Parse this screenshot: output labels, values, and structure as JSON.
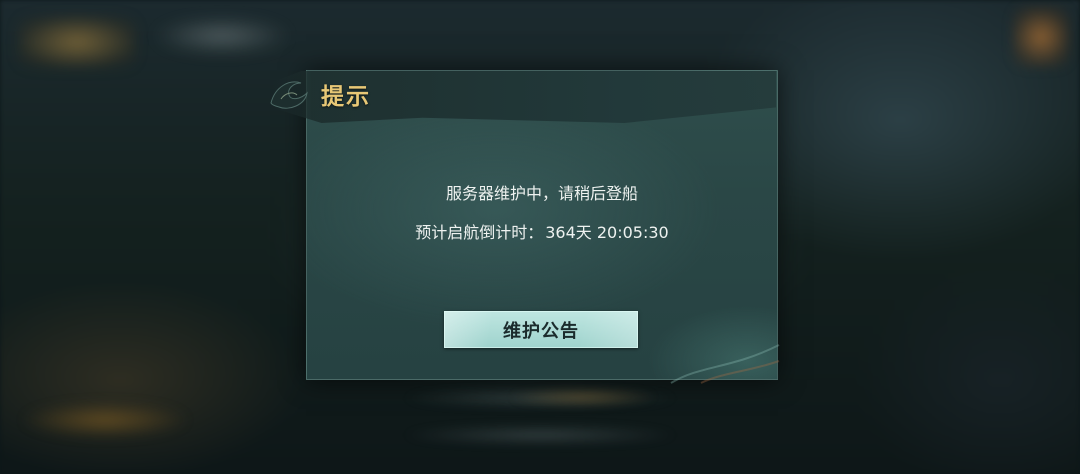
{
  "dialog": {
    "title": "提示",
    "message": "服务器维护中，请稍后登船",
    "countdown_label": "预计启航倒计时：",
    "countdown_value": "364天 20:05:30",
    "notice_button_label": "维护公告"
  },
  "colors": {
    "title": "#e8c876",
    "panel": "#2a4746",
    "button": "#aedcd6",
    "button_text": "#1b2b2c",
    "message_text": "#eef2f0"
  }
}
